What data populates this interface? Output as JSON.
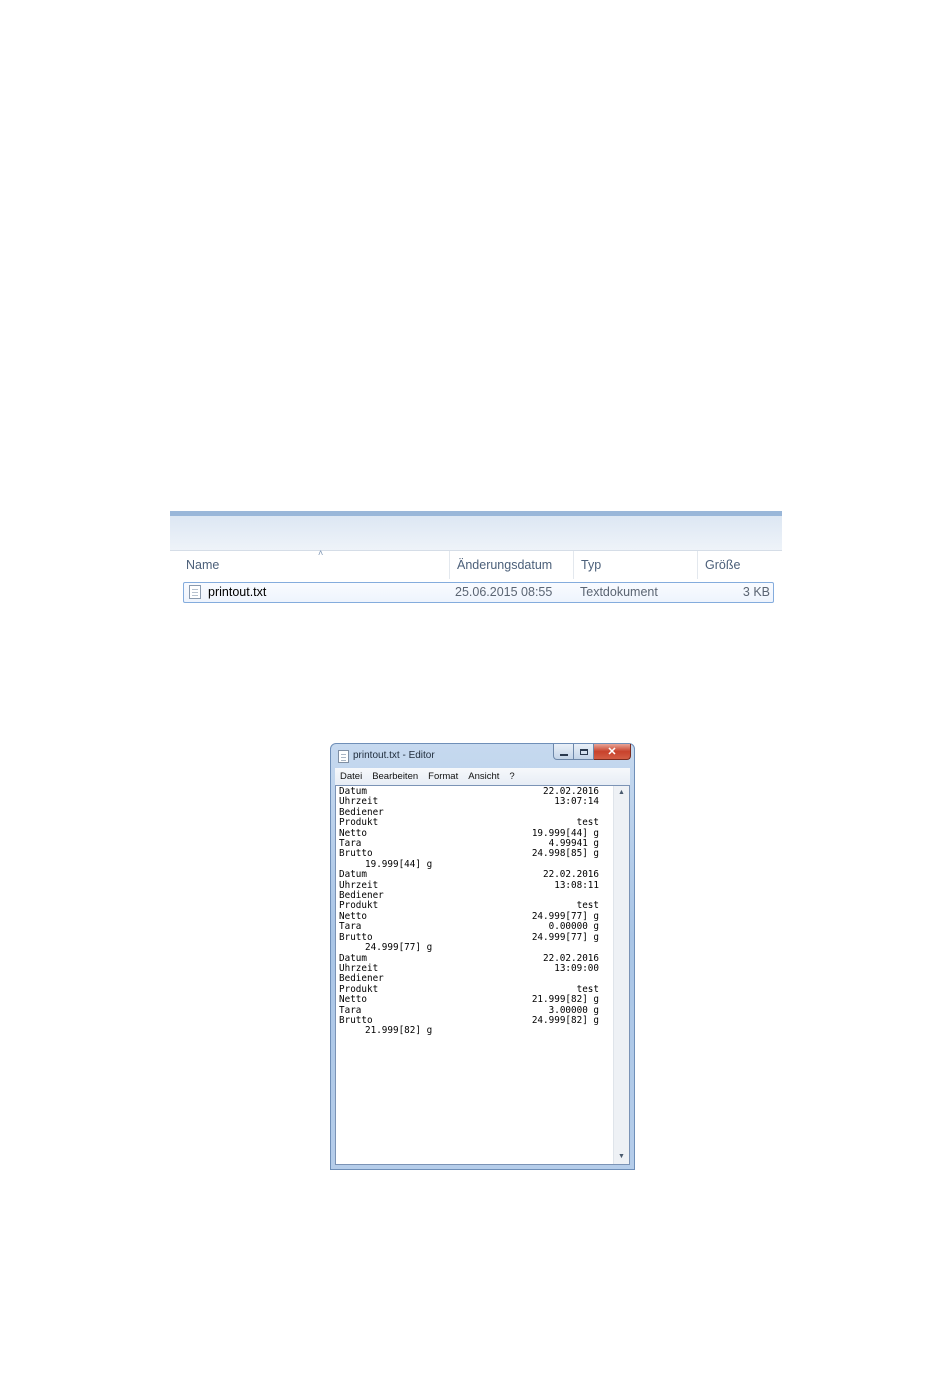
{
  "explorer": {
    "columns": {
      "name": "Name",
      "modified": "Änderungsdatum",
      "type": "Typ",
      "size": "Größe"
    },
    "files": [
      {
        "name": "printout.txt",
        "modified": "25.06.2015 08:55",
        "type": "Textdokument",
        "size": "3 KB"
      }
    ]
  },
  "notepad": {
    "title": "printout.txt - Editor",
    "menu": [
      "Datei",
      "Bearbeiten",
      "Format",
      "Ansicht",
      "?"
    ],
    "records": [
      {
        "rows": [
          {
            "label": "Datum",
            "value": "22.02.2016"
          },
          {
            "label": "Uhrzeit",
            "value": "13:07:14"
          },
          {
            "label": "Bediener",
            "value": ""
          },
          {
            "label": "Produkt",
            "value": "test"
          },
          {
            "label": "Netto",
            "value": "19.999[44] g"
          },
          {
            "label": "Tara",
            "value": "4.99941 g"
          },
          {
            "label": "Brutto",
            "value": "24.998[85] g"
          }
        ],
        "total": "19.999[44] g"
      },
      {
        "rows": [
          {
            "label": "Datum",
            "value": "22.02.2016"
          },
          {
            "label": "Uhrzeit",
            "value": "13:08:11"
          },
          {
            "label": "Bediener",
            "value": ""
          },
          {
            "label": "Produkt",
            "value": "test"
          },
          {
            "label": "Netto",
            "value": "24.999[77] g"
          },
          {
            "label": "Tara",
            "value": "0.00000 g"
          },
          {
            "label": "Brutto",
            "value": "24.999[77] g"
          }
        ],
        "total": "24.999[77] g"
      },
      {
        "rows": [
          {
            "label": "Datum",
            "value": "22.02.2016"
          },
          {
            "label": "Uhrzeit",
            "value": "13:09:00"
          },
          {
            "label": "Bediener",
            "value": ""
          },
          {
            "label": "Produkt",
            "value": "test"
          },
          {
            "label": "Netto",
            "value": "21.999[82] g"
          },
          {
            "label": "Tara",
            "value": "3.00000 g"
          },
          {
            "label": "Brutto",
            "value": "24.999[82] g"
          }
        ],
        "total": "21.999[82] g"
      }
    ]
  }
}
